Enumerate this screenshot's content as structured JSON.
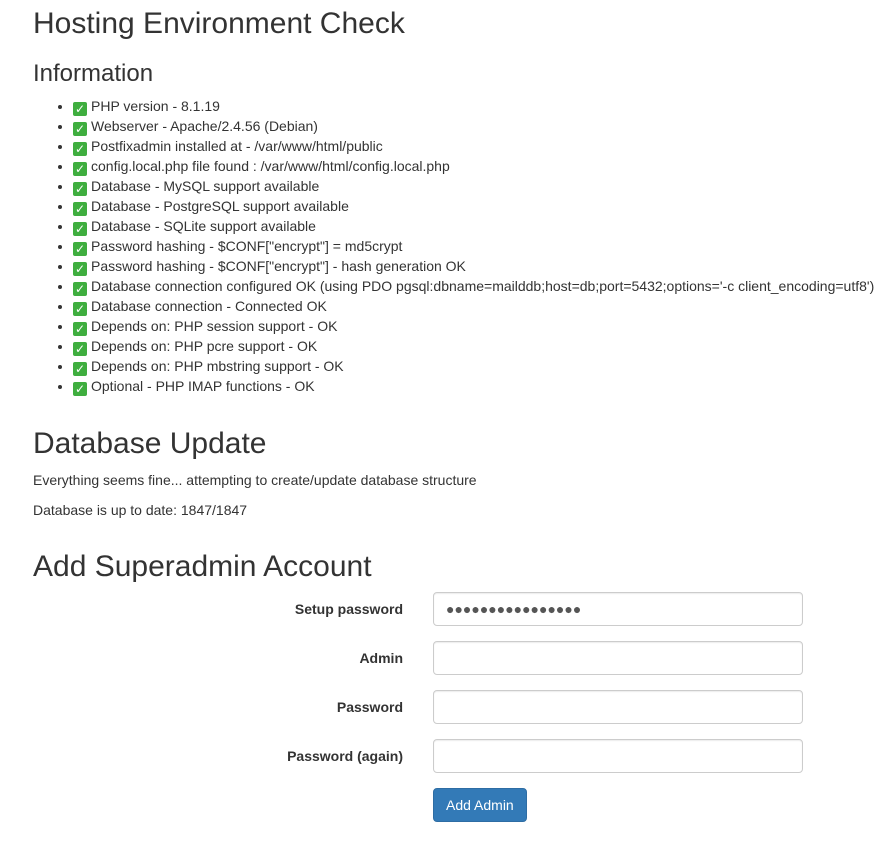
{
  "page_title": "Hosting Environment Check",
  "information": {
    "heading": "Information",
    "checks": [
      {
        "icon": "check-mark-icon",
        "text": "PHP version - 8.1.19"
      },
      {
        "icon": "check-mark-icon",
        "text": "Webserver - Apache/2.4.56 (Debian)"
      },
      {
        "icon": "check-mark-icon",
        "text": "Postfixadmin installed at - /var/www/html/public"
      },
      {
        "icon": "check-mark-icon",
        "text": "config.local.php file found : /var/www/html/config.local.php"
      },
      {
        "icon": "check-mark-icon",
        "text": "Database - MySQL support available"
      },
      {
        "icon": "check-mark-icon",
        "text": "Database - PostgreSQL support available"
      },
      {
        "icon": "check-mark-icon",
        "text": "Database - SQLite support available"
      },
      {
        "icon": "check-mark-icon",
        "text": "Password hashing - $CONF[\"encrypt\"] = md5crypt"
      },
      {
        "icon": "check-mark-icon",
        "text": "Password hashing - $CONF[\"encrypt\"] - hash generation OK"
      },
      {
        "icon": "check-mark-icon",
        "text": "Database connection configured OK (using PDO pgsql:dbname=mailddb;host=db;port=5432;options='-c client_encoding=utf8')"
      },
      {
        "icon": "check-mark-icon",
        "text": "Database connection - Connected OK"
      },
      {
        "icon": "check-mark-icon",
        "text": "Depends on: PHP session support - OK"
      },
      {
        "icon": "check-mark-icon",
        "text": "Depends on: PHP pcre support - OK"
      },
      {
        "icon": "check-mark-icon",
        "text": "Depends on: PHP mbstring support - OK"
      },
      {
        "icon": "check-mark-icon",
        "text": "Optional - PHP IMAP functions - OK"
      }
    ]
  },
  "database_update": {
    "heading": "Database Update",
    "status_line": "Everything seems fine... attempting to create/update database structure",
    "result_line": "Database is up to date: 1847/1847"
  },
  "superadmin": {
    "heading": "Add Superadmin Account",
    "setup_password": {
      "label": "Setup password",
      "value": "●●●●●●●●●●●●●●●●"
    },
    "admin": {
      "label": "Admin",
      "value": ""
    },
    "password": {
      "label": "Password",
      "value": ""
    },
    "password_again": {
      "label": "Password (again)",
      "value": ""
    },
    "submit_label": "Add Admin"
  },
  "colors": {
    "check_icon": "#3fae3f",
    "primary_button": "#337ab7",
    "text": "#333333"
  }
}
